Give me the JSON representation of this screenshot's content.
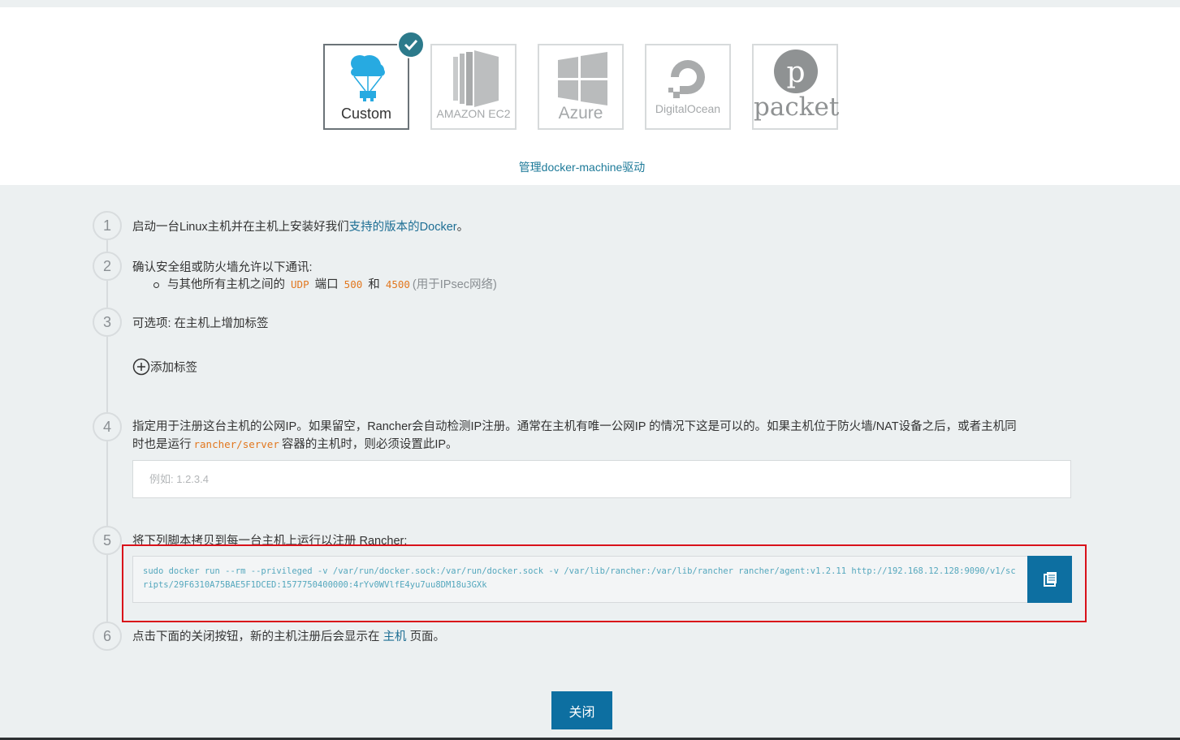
{
  "drivers": [
    {
      "name": "custom",
      "label": "Custom",
      "selected": true
    },
    {
      "name": "amazon-ec2",
      "label": "AMAZON EC2",
      "selected": false
    },
    {
      "name": "azure",
      "label": "Azure",
      "selected": false
    },
    {
      "name": "digitalocean",
      "label": "DigitalOcean",
      "selected": false
    },
    {
      "name": "packet",
      "label": "packet",
      "selected": false
    }
  ],
  "manage_link": "管理docker-machine驱动",
  "steps": {
    "s1": {
      "num": "1",
      "pre": "启动一台Linux主机并在主机上安装好我们",
      "link": "支持的版本的",
      "link2": "Docker",
      "post": "。"
    },
    "s2": {
      "num": "2",
      "title": "确认安全组或防火墙允许以下通讯:",
      "bullet_pre": "与其他所有主机之间的",
      "udp": "UDP",
      "port_word": "端口",
      "port1": "500",
      "and": "和",
      "port2": "4500",
      "note": "(用于IPsec网络)"
    },
    "s3": {
      "num": "3",
      "title": "可选项: 在主机上增加标签",
      "add_label": "添加标签"
    },
    "s4": {
      "num": "4",
      "line1": "指定用于注册这台主机的公网IP。如果留空，Rancher会自动检测IP注册。通常在主机有唯一公网IP 的情况下这是可以的。如果主机位于防火墙/NAT设备之后，或者主机同",
      "line2_pre": "时也是运行",
      "code": "rancher/server",
      "line2_post": "容器的主机时，则必须设置此IP。",
      "placeholder": "例如: 1.2.3.4",
      "value": ""
    },
    "s5": {
      "num": "5",
      "title": "将下列脚本拷贝到每一台主机上运行以注册 Rancher:",
      "command": "sudo docker run --rm --privileged -v /var/run/docker.sock:/var/run/docker.sock -v /var/lib/rancher:/var/lib/rancher rancher/agent:v1.2.11 http://192.168.12.128:9090/v1/scripts/29F6310A75BAE5F1DCED:1577750400000:4rYv0WVlfE4yu7uu8DM18u3GXk"
    },
    "s6": {
      "num": "6",
      "pre": "点击下面的关闭按钮，新的主机注册后会显示在",
      "link": "主机",
      "post": "页面。"
    }
  },
  "close_button": "关闭",
  "colors": {
    "accent": "#0d6fa1",
    "link": "#1d6e94",
    "code": "#e2771e",
    "highlight": "#d9111a"
  }
}
